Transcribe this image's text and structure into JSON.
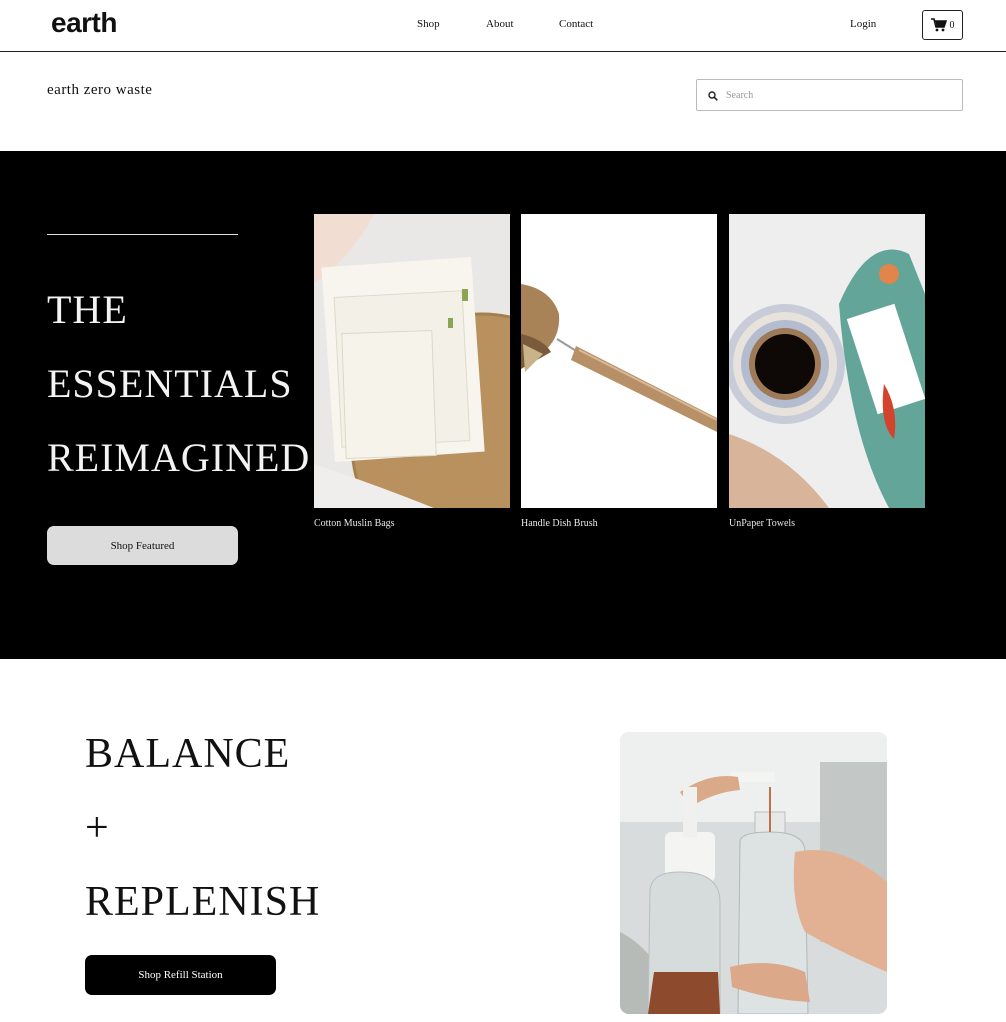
{
  "header": {
    "logo": "earth",
    "nav": [
      "Shop",
      "About",
      "Contact"
    ],
    "login": "Login",
    "cart_count": "0"
  },
  "subheader": {
    "site_name": "earth zero waste",
    "search_placeholder": "Search"
  },
  "hero": {
    "title_lines": [
      "THE",
      "ESSENTIALS",
      "REIMAGINED"
    ],
    "button": "Shop Featured",
    "products": [
      {
        "name": "Cotton Muslin Bags",
        "image": "cotton-muslin-bags-photo"
      },
      {
        "name": "Handle Dish Brush",
        "image": "handle-dish-brush-photo"
      },
      {
        "name": "UnPaper Towels",
        "image": "unpaper-towels-photo"
      }
    ]
  },
  "refill": {
    "lines": [
      "BALANCE",
      "+",
      "REPLENISH"
    ],
    "button": "Shop Refill Station",
    "image": "refill-station-photo"
  },
  "colors": {
    "hero_bg": "#000000",
    "featured_button": "#dcdcdc",
    "refill_button": "#000000"
  }
}
